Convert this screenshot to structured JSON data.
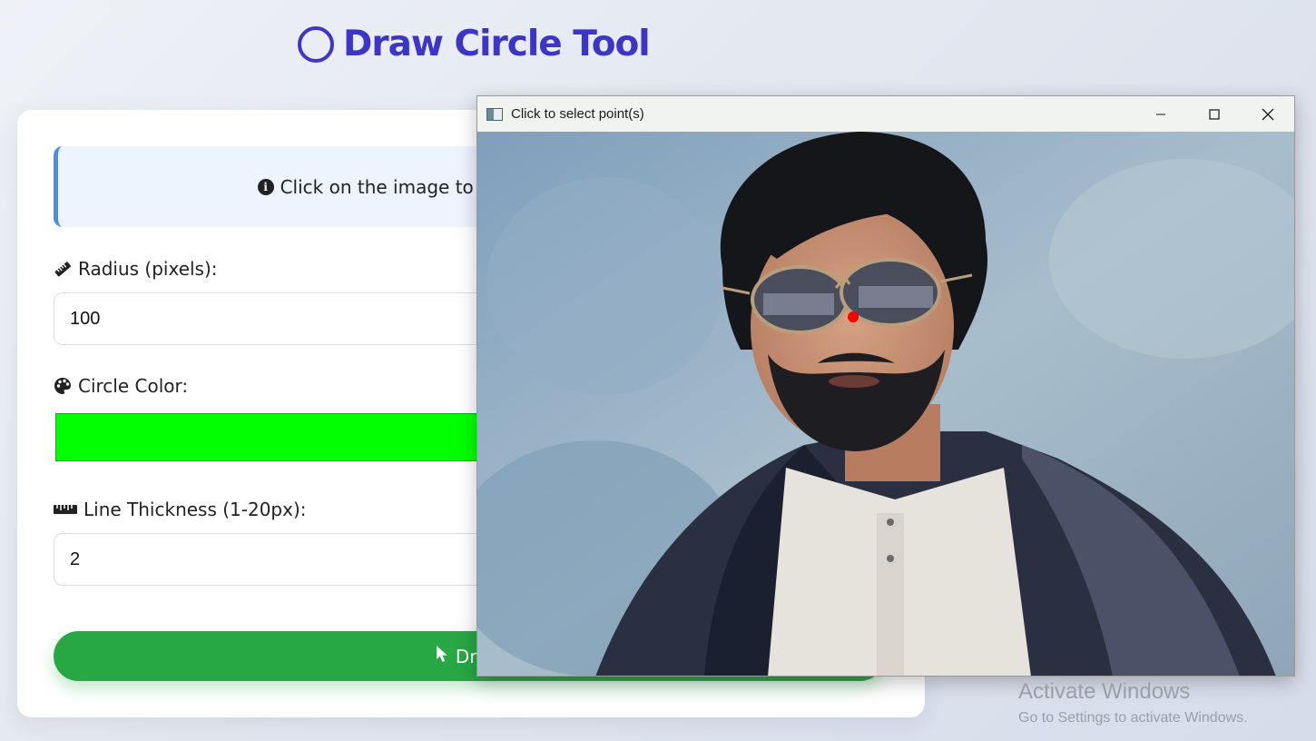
{
  "page": {
    "title": "Draw Circle Tool",
    "title_icon": "circle-outline-icon",
    "accent_color": "#3c35c7"
  },
  "card": {
    "info_text": "Click on the image to place the circle center",
    "info_icon": "info-circle-icon",
    "radius": {
      "label": "Radius (pixels):",
      "icon": "ruler-diagonal-icon",
      "value": "100"
    },
    "color": {
      "label": "Circle Color:",
      "icon": "palette-icon",
      "value": "#00ff00"
    },
    "thickness": {
      "label": "Line Thickness (1-20px):",
      "icon": "ruler-horizontal-icon",
      "value": "2"
    },
    "draw_button": {
      "label": "Draw",
      "icon": "mouse-pointer-icon",
      "color": "#28a745"
    }
  },
  "popup": {
    "title": "Click to select point(s)",
    "app_icon": "image-window-icon",
    "controls": [
      "minimize-icon",
      "maximize-icon",
      "close-icon"
    ],
    "selected_point_color": "#ff0000"
  },
  "watermark": {
    "title": "Activate Windows",
    "subtitle": "Go to Settings to activate Windows."
  }
}
